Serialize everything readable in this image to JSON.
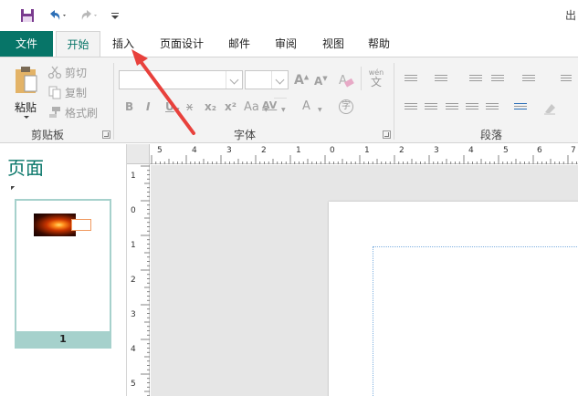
{
  "quick_access": {
    "save_icon": "save-icon",
    "undo_icon": "undo-icon",
    "redo_icon": "redo-icon",
    "customize_icon": "customize-qat-icon",
    "window_title": "出"
  },
  "tabs": [
    {
      "label": "文件"
    },
    {
      "label": "开始"
    },
    {
      "label": "插入"
    },
    {
      "label": "页面设计"
    },
    {
      "label": "邮件"
    },
    {
      "label": "审阅"
    },
    {
      "label": "视图"
    },
    {
      "label": "帮助"
    }
  ],
  "ribbon": {
    "clipboard": {
      "paste": "粘贴",
      "cut": "剪切",
      "copy": "复制",
      "format_painter": "格式刷",
      "group_label": "剪贴板"
    },
    "font": {
      "group_label": "字体",
      "font_name": "",
      "font_size": "",
      "grow": "A",
      "shrink": "A",
      "bold": "B",
      "italic": "I",
      "underline": "U",
      "strikethrough": "x",
      "subscript": "x₂",
      "superscript": "x²",
      "change_case": "Aa",
      "char_spacing": "AV",
      "font_color": "A",
      "phonetic_top": "wén",
      "phonetic_bottom": "文",
      "enclose": "字"
    },
    "paragraph": {
      "group_label": "段落"
    }
  },
  "pages_pane": {
    "title": "页面",
    "page_number": "1"
  },
  "ruler": {
    "h_labels": [
      "5",
      "4",
      "3",
      "2",
      "1",
      "0",
      "1",
      "2",
      "3",
      "4",
      "5",
      "6",
      "7"
    ],
    "v_labels": [
      "1",
      "0",
      "1",
      "2",
      "3",
      "4",
      "5"
    ]
  },
  "colors": {
    "accent": "#077568",
    "ribbon_bg": "#f3f3f3",
    "canvas_bg": "#e6e6e6",
    "annotation_arrow": "#e8413c"
  }
}
